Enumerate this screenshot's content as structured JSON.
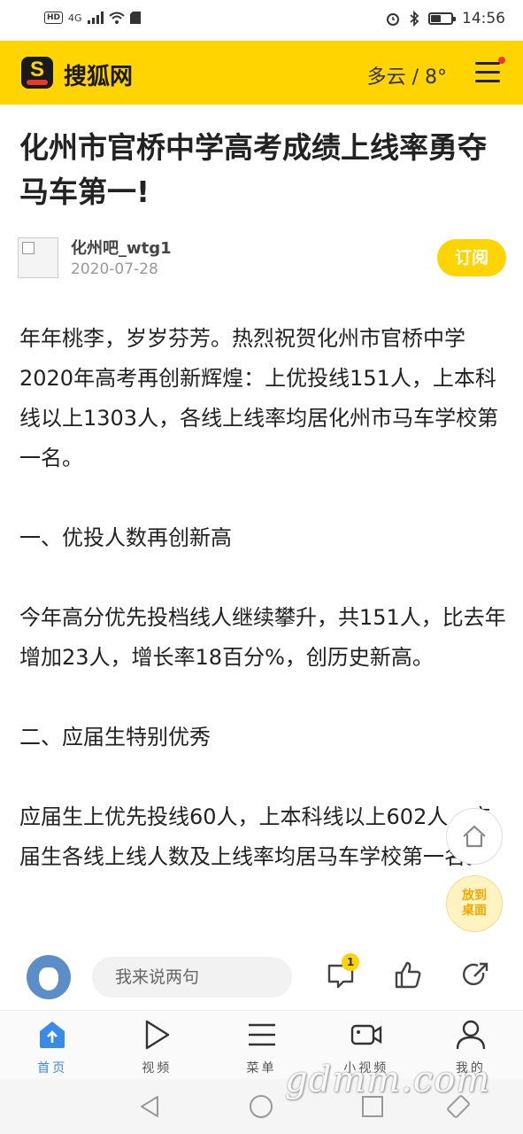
{
  "status_bar": {
    "network": "4G",
    "hd": "HD",
    "time": "14:56"
  },
  "header": {
    "brand": "搜狐网",
    "logo_letter": "S",
    "weather": "多云 / 8°",
    "notification_dot": true
  },
  "article": {
    "title": "化州市官桥中学高考成绩上线率勇夺马车第一!",
    "author": "化州吧_wtg1",
    "date": "2020-07-28",
    "subscribe_label": "订阅",
    "paragraphs": [
      "年年桃李，岁岁芬芳。热烈祝贺化州市官桥中学2020年高考再创新辉煌：上优投线151人，上本科线以上1303人，各线上线率均居化州市马车学校第一名。",
      "一、优投人数再创新高",
      "今年高分优先投档线人继续攀升，共151人，比去年增加23人，增长率18百分%，创历史新高。",
      "二、应届生特别优秀",
      "应届生上优先投线60人，上本科线以上602人，应届生各线上线人数及上线率均居马车学校第一名。"
    ]
  },
  "floating": {
    "desktop_label": "放到桌面"
  },
  "comment_bar": {
    "input_placeholder": "我来说两句",
    "comment_count": "1"
  },
  "tabs": [
    {
      "label": "首页",
      "icon": "home-icon",
      "active": true
    },
    {
      "label": "视频",
      "icon": "play-icon",
      "active": false
    },
    {
      "label": "菜单",
      "icon": "menu-icon",
      "active": false
    },
    {
      "label": "小视频",
      "icon": "camera-icon",
      "active": false
    },
    {
      "label": "我的",
      "icon": "user-icon",
      "active": false
    }
  ],
  "watermark": "gdmm.com",
  "colors": {
    "brand_yellow": "#ffd400",
    "active_blue": "#3a8be8",
    "badge_red": "#e8392b"
  }
}
